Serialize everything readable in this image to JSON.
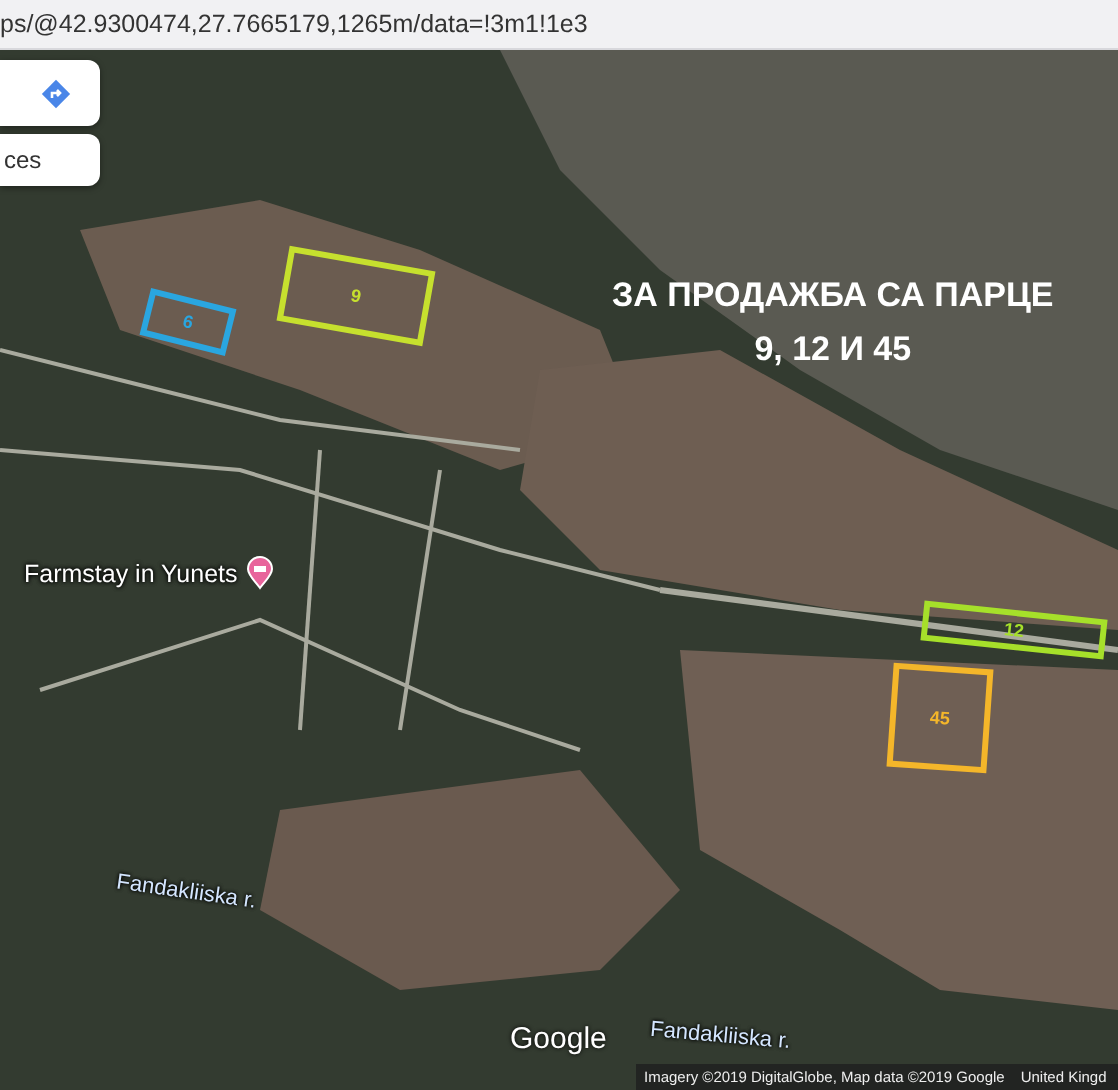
{
  "address_bar": {
    "url": "ps/@42.9300474,27.7665179,1265m/data=!3m1!1e3"
  },
  "search_panel": {
    "suggestion": "ces"
  },
  "map": {
    "headline": [
      "ЗА ПРОДАЖБА СА ПАРЦЕ",
      "9, 12 И 45"
    ],
    "plots": [
      {
        "label": "6",
        "color": "#2aa6e0"
      },
      {
        "label": "9",
        "color": "#c6e02e"
      },
      {
        "label": "12",
        "color": "#a6e02a"
      },
      {
        "label": "45",
        "color": "#f4b62a"
      }
    ],
    "places": [
      {
        "label": "Farmstay in Yunets",
        "kind": "poi"
      },
      {
        "label": "Fandakliiska r.",
        "kind": "river"
      },
      {
        "label": "Fandakliiska r.",
        "kind": "river"
      }
    ],
    "logo": "Google",
    "attribution": "Imagery ©2019 DigitalGlobe, Map data ©2019 Google",
    "region_link": "United Kingd"
  }
}
